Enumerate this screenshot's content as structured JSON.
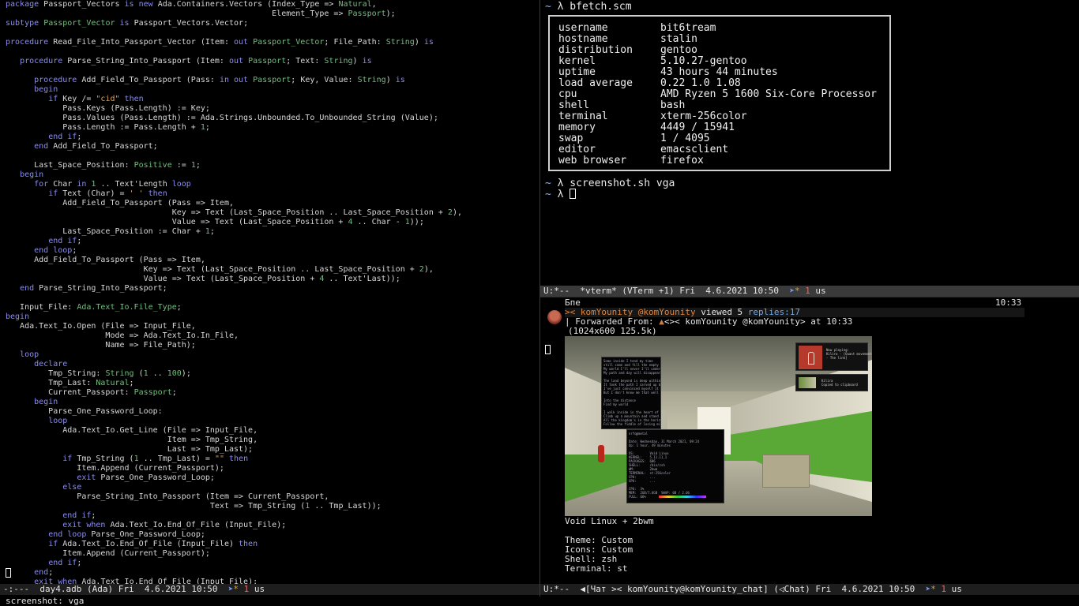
{
  "editor": {
    "code_lines": [
      "package Passport_Vectors is new Ada.Containers.Vectors (Index_Type => Natural,",
      "                                                        Element_Type => Passport);",
      "subtype Passport_Vector is Passport_Vectors.Vector;",
      "",
      "procedure Read_File_Into_Passport_Vector (Item: out Passport_Vector; File_Path: String) is",
      "",
      "   procedure Parse_String_Into_Passport (Item: out Passport; Text: String) is",
      "",
      "      procedure Add_Field_To_Passport (Pass: in out Passport; Key, Value: String) is",
      "      begin",
      "         if Key /= \"cid\" then",
      "            Pass.Keys (Pass.Length) := Key;",
      "            Pass.Values (Pass.Length) := Ada.Strings.Unbounded.To_Unbounded_String (Value);",
      "            Pass.Length := Pass.Length + 1;",
      "         end if;",
      "      end Add_Field_To_Passport;",
      "",
      "      Last_Space_Position: Positive := 1;",
      "   begin",
      "      for Char in 1 .. Text'Length loop",
      "         if Text (Char) = ' ' then",
      "            Add_Field_To_Passport (Pass => Item,",
      "                                   Key => Text (Last_Space_Position .. Last_Space_Position + 2),",
      "                                   Value => Text (Last_Space_Position + 4 .. Char - 1));",
      "            Last_Space_Position := Char + 1;",
      "         end if;",
      "      end loop;",
      "      Add_Field_To_Passport (Pass => Item,",
      "                             Key => Text (Last_Space_Position .. Last_Space_Position + 2),",
      "                             Value => Text (Last_Space_Position + 4 .. Text'Last));",
      "   end Parse_String_Into_Passport;",
      "",
      "   Input_File: Ada.Text_Io.File_Type;",
      "begin",
      "   Ada.Text_Io.Open (File => Input_File,",
      "                     Mode => Ada.Text_Io.In_File,",
      "                     Name => File_Path);",
      "   loop",
      "      declare",
      "         Tmp_String: String (1 .. 100);",
      "         Tmp_Last: Natural;",
      "         Current_Passport: Passport;",
      "      begin",
      "         Parse_One_Password_Loop:",
      "         loop",
      "            Ada.Text_Io.Get_Line (File => Input_File,",
      "                                  Item => Tmp_String,",
      "                                  Last => Tmp_Last);",
      "            if Tmp_String (1 .. Tmp_Last) = \"\" then",
      "               Item.Append (Current_Passport);",
      "               exit Parse_One_Password_Loop;",
      "            else",
      "               Parse_String_Into_Passport (Item => Current_Passport,",
      "                                           Text => Tmp_String (1 .. Tmp_Last));",
      "            end if;",
      "            exit when Ada.Text_Io.End_Of_File (Input_File);",
      "         end loop Parse_One_Password_Loop;",
      "         if Ada.Text_Io.End_Of_File (Input_File) then",
      "            Item.Append (Current_Passport);",
      "         end if;",
      "      end;",
      "      exit when Ada.Text_Io.End_Of_File (Input_File);"
    ],
    "modeline": {
      "prefix": "-:---  ",
      "buffer": "day4.adb",
      "mode": " (Ada) Fri  4.6.2021 10:50  ",
      "count": "1",
      "suffix": " us"
    }
  },
  "terminal": {
    "cmd1_prompt": "~ ",
    "cmd1": "λ bfetch.scm",
    "bfetch": [
      {
        "key": "username",
        "value": "bit6tream"
      },
      {
        "key": "hostname",
        "value": "stalin"
      },
      {
        "key": "distribution",
        "value": "gentoo"
      },
      {
        "key": "kernel",
        "value": "5.10.27-gentoo"
      },
      {
        "key": "uptime",
        "value": "43 hours 44 minutes"
      },
      {
        "key": "load average",
        "value": "0.22 1.0 1.08"
      },
      {
        "key": "cpu",
        "value": "AMD Ryzen 5 1600 Six-Core Processor"
      },
      {
        "key": "shell",
        "value": "bash"
      },
      {
        "key": "terminal",
        "value": "xterm-256color"
      },
      {
        "key": "memory",
        "value": "4449 / 15941"
      },
      {
        "key": "swap",
        "value": "1 / 4095"
      },
      {
        "key": "editor",
        "value": "emacsclient"
      },
      {
        "key": "web browser",
        "value": "firefox"
      }
    ],
    "cmd2_prompt": "~ ",
    "cmd2": "λ screenshot.sh vga",
    "cmd3_prompt": "~ ",
    "cmd3": "λ ",
    "modeline": {
      "prefix": "U:*--  ",
      "buffer": "*vterm*",
      "mode": " (VTerm +1) Fri  4.6.2021 10:50  ",
      "count": "1",
      "suffix": " us"
    }
  },
  "chat": {
    "date_header": "Бпе",
    "time": "10:33",
    "sender": "komYounity @komYounity",
    "sender_prefix": ">< ",
    "viewed": " viewed 5 ",
    "replies": "replies:17",
    "forwarded_label": "| Forwarded From: ",
    "forwarded_from": "<>< komYounity @komYounity>",
    "forwarded_at": " at 10:33",
    "image_meta": "(1024x600 125.5k)",
    "message_lines": [
      "Void Linux + 2bwm",
      "",
      "Theme: Custom",
      "Icons: Custom",
      "Shell: zsh",
      "Terminal: st"
    ],
    "screenshot_texts": {
      "now_playing": "Now playing:\nKilira - [Quant movement\n- The link]",
      "clipboard": "Kilira\nCopied to clipboard",
      "mini_term_1": "Some inside I tend my time\nstill come and fill the empty space\nMy world I'll never I'll understand\nMy path and day will disappear\n\nThe land beyond is deep within\nIt took the path I carved up back\nI've just convinced myself it all\nBut I don't know me that well as you see\n\nInto the distance\nFind my world\n\nI walk inside in the heart of my kingdom\nClimb up a mountain and stand on the top of it\nAll the kingdom's in the horizon\nFollow the fiddle of losing mighty power",
      "mini_term_2": "nrfq@metal\n\nDate: Wednesday, 31 March 2021, 09:24\nUp: 1 hour, 49 minutes\n\nOS:        Void Linux\nKERNEL:    5.11.11_1\nPACKAGES:  606\nSHELL:     /bin/zsh\nWM:        2bwm\nTERMINAL:  st-256color\nCPU:       ...\nGPU:       ...\n\nCPU:  3%\nMEM:  2GB/7.6GB  SWAP: 0B / 2.0G\nFULL: 66%\n\nSONG:   Kilira - [Quant movement - The link]\nCOLORS:"
    },
    "modeline": {
      "prefix": "U:*--  ",
      "buffer": "◀[Чат >< komYounity@komYounity_chat]",
      "mode": " (◁Chat) Fri  4.6.2021 10:50  ",
      "count": "1",
      "suffix": " us"
    }
  },
  "minibuffer": {
    "text": "screenshot: vga"
  },
  "colors": {
    "background": "#000000",
    "keyword": "#8c8cf0",
    "type": "#6ec07a",
    "string": "#e0a04c",
    "modeline": "#1e1e1e",
    "telegram_icon": "#7a9ef5"
  },
  "icons": {
    "telegram": "telegram-icon",
    "cursor": "block-cursor"
  }
}
